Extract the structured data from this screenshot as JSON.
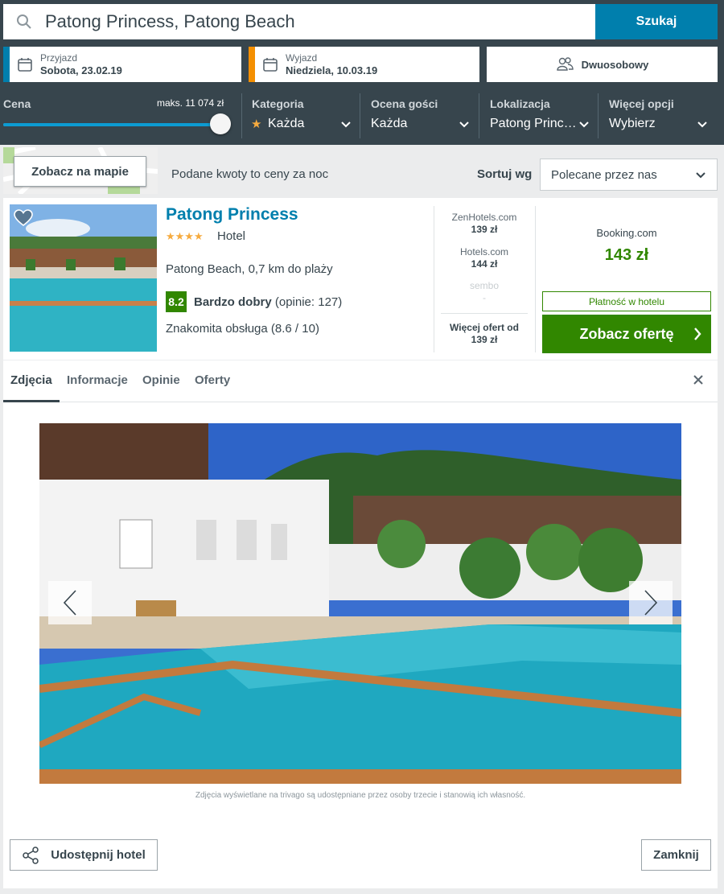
{
  "search": {
    "query": "Patong Princess, Patong Beach",
    "button_label": "Szukaj",
    "icon": "search-icon"
  },
  "dates": {
    "checkin_label": "Przyjazd",
    "checkin_value": "Sobota, 23.02.19",
    "checkout_label": "Wyjazd",
    "checkout_value": "Niedziela, 10.03.19",
    "checkin_accent": "#007fad",
    "checkout_accent": "#f48f00"
  },
  "room": {
    "label": "Dwuosobowy",
    "icon": "guests-icon"
  },
  "filters": {
    "price_label": "Cena",
    "price_max": "maks. 11 074 zł",
    "price_slider_level": 1.0,
    "category_label": "Kategoria",
    "category_value": "Każda",
    "category_star": "★",
    "rating_label": "Ocena gości",
    "rating_value": "Każda",
    "location_label": "Lokalizacja",
    "location_value": "Patong Princ…",
    "more_label": "Więcej opcji",
    "more_value": "Wybierz"
  },
  "toolbar": {
    "map_button": "Zobacz na mapie",
    "price_note": "Podane kwoty to ceny za noc",
    "sort_label": "Sortuj wg",
    "sort_value": "Polecane przez nas"
  },
  "hotel": {
    "name": "Patong Princess",
    "stars": "★★★★",
    "star_count": 4,
    "type": "Hotel",
    "location": "Patong Beach, 0,7 km do plaży",
    "rating_score": "8.2",
    "rating_word": "Bardzo dobry",
    "rating_reviews": "(opinie: 127)",
    "service": "Znakomita obsługa (8.6 / 10)"
  },
  "offers": [
    {
      "site": "ZenHotels.com",
      "price": "139 zł"
    },
    {
      "site": "Hotels.com",
      "price": "144 zł"
    },
    {
      "site": "sembo",
      "price": "-"
    }
  ],
  "more_offers": {
    "line1": "Więcej ofert od",
    "line2": "139 zł"
  },
  "best_offer": {
    "site": "Booking.com",
    "price": "143 zł",
    "payment": "Płatność w hotelu",
    "button": "Zobacz ofertę"
  },
  "tabs": [
    "Zdjęcia",
    "Informacje",
    "Opinie",
    "Oferty"
  ],
  "gallery": {
    "disclaimer": "Zdjęcia wyświetlane na trivago są udostępniane przez osoby trzecie i stanowią ich własność."
  },
  "footer": {
    "share_button": "Udostępnij hotel",
    "close_button": "Zamknij"
  },
  "colors": {
    "header_bg": "#37454d",
    "brand_blue": "#007fad",
    "green": "#318700"
  }
}
